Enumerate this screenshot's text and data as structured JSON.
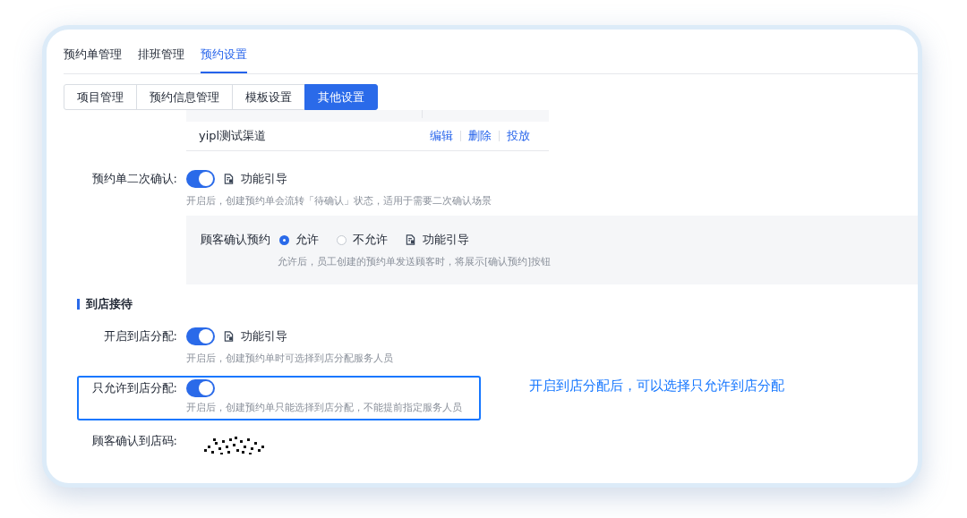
{
  "tabs": [
    {
      "label": "预约单管理",
      "selected": false
    },
    {
      "label": "排班管理",
      "selected": false
    },
    {
      "label": "预约设置",
      "selected": true
    }
  ],
  "sub_tabs": [
    {
      "label": "项目管理",
      "selected": false
    },
    {
      "label": "预约信息管理",
      "selected": false
    },
    {
      "label": "模板设置",
      "selected": false
    },
    {
      "label": "其他设置",
      "selected": true
    }
  ],
  "channel_table": {
    "rows": [
      {
        "name": "yipl测试渠道",
        "actions": [
          "编辑",
          "删除",
          "投放"
        ]
      }
    ]
  },
  "secondary_confirm": {
    "label": "预约单二次确认:",
    "on": true,
    "guide": "功能引导",
    "hint": "开启后，创建预约单会流转「待确认」状态，适用于需要二次确认场景"
  },
  "customer_confirm": {
    "label": "顾客确认预约",
    "options": [
      {
        "label": "允许",
        "selected": true
      },
      {
        "label": "不允许",
        "selected": false
      }
    ],
    "guide": "功能引导",
    "hint": "允许后，员工创建的预约单发送顾客时，将展示[确认预约]按钮"
  },
  "section_title": "到店接待",
  "store_assign": {
    "label": "开启到店分配:",
    "on": true,
    "guide": "功能引导",
    "hint": "开启后，创建预约单时可选择到店分配服务人员"
  },
  "only_store_assign": {
    "label": "只允许到店分配:",
    "on": true,
    "highlighted": true,
    "hint": "开启后，创建预约单只能选择到店分配，不能提前指定服务人员"
  },
  "annotation": "开启到店分配后，可以选择只允许到店分配",
  "arrival_code": {
    "label": "顾客确认到店码:"
  }
}
